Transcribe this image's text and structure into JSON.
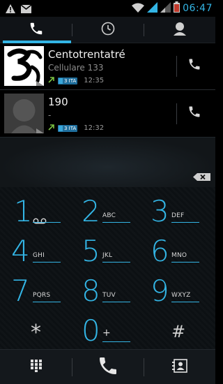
{
  "status_bar": {
    "time": "06:47",
    "icons": [
      "warning-icon",
      "gmail-icon",
      "wifi-icon",
      "signal-icon",
      "signal-icon",
      "battery-icon"
    ]
  },
  "tabs": [
    {
      "icon": "phone-icon",
      "selected": true
    },
    {
      "icon": "clock-icon",
      "selected": false
    },
    {
      "icon": "contact-icon",
      "selected": false
    }
  ],
  "call_log": [
    {
      "name": "Centotrentatré",
      "detail": "Cellulare 133",
      "carrier": "3 ITA",
      "time": "12:35",
      "type": "outgoing",
      "avatar": "three-logo"
    },
    {
      "name": "190",
      "detail": "-",
      "carrier": "3 ITA",
      "time": "12:32",
      "type": "outgoing",
      "avatar": "default-contact"
    }
  ],
  "keypad": [
    {
      "digit": "1",
      "letters": ""
    },
    {
      "digit": "2",
      "letters": "ABC"
    },
    {
      "digit": "3",
      "letters": "DEF"
    },
    {
      "digit": "4",
      "letters": "GHI"
    },
    {
      "digit": "5",
      "letters": "JKL"
    },
    {
      "digit": "6",
      "letters": "MNO"
    },
    {
      "digit": "7",
      "letters": "PQRS"
    },
    {
      "digit": "8",
      "letters": "TUV"
    },
    {
      "digit": "9",
      "letters": "WXYZ"
    },
    {
      "digit": "*",
      "letters": ""
    },
    {
      "digit": "0",
      "letters": "+"
    },
    {
      "digit": "#",
      "letters": ""
    }
  ],
  "colors": {
    "accent": "#33b5e5",
    "outgoing_arrow": "#7cc242"
  }
}
